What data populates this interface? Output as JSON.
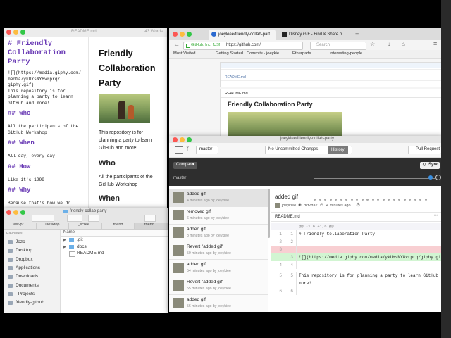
{
  "colors": {
    "accent": "#2d7bd4",
    "md_heading": "#6a3bb5",
    "deletion": "#f8cfd2",
    "addition": "#d2f5d2"
  },
  "editor": {
    "file": "README.md",
    "words": "43 Words",
    "md_lines": [
      {
        "kind": "h",
        "text": "# Friendly"
      },
      {
        "kind": "h",
        "text": "Collaboration"
      },
      {
        "kind": "h",
        "text": "Party"
      },
      {
        "kind": "t",
        "text": "![](https://media.giphy.com/"
      },
      {
        "kind": "t",
        "text": "media/ykUYsNY8vrprq/"
      },
      {
        "kind": "t",
        "text": "giphy.gif)"
      },
      {
        "kind": "t",
        "text": "This repository is for"
      },
      {
        "kind": "t",
        "text": "planning a party to learn"
      },
      {
        "kind": "t",
        "text": "GitHub and more!"
      },
      {
        "kind": "h2",
        "text": "## Who"
      },
      {
        "kind": "t",
        "text": "All the participants of the"
      },
      {
        "kind": "t",
        "text": "GitHub Workshop"
      },
      {
        "kind": "h2",
        "text": "## When"
      },
      {
        "kind": "t",
        "text": "All day, every day"
      },
      {
        "kind": "h2",
        "text": "## How"
      },
      {
        "kind": "t",
        "text": "Like it's 1999"
      },
      {
        "kind": "h2",
        "text": "## Why"
      },
      {
        "kind": "t",
        "text": "Because that's how we do"
      }
    ],
    "preview": {
      "title": "Friendly Collaboration Party",
      "para": "This repository is for planning a party to learn GitHub and more!",
      "who": "Who",
      "who_text": "All the participants of the GitHub Workshop",
      "when": "When"
    }
  },
  "browser": {
    "tabs": [
      {
        "label": "joeykiee/friendly-collab-part",
        "active": true
      },
      {
        "label": "Disney GIF - Find & Share o",
        "active": false
      }
    ],
    "secure_label": "GitHub, Inc. [US]",
    "url": "https://github.com/",
    "search_placeholder": "Search",
    "bookmarks": [
      "Most Visited",
      "Getting Started",
      "Commits · joeykie...",
      "Etherpads",
      "interesting-people"
    ],
    "page_rows": [
      "README.md",
      "README.md"
    ],
    "readme_title": "Friendly Collaboration Party"
  },
  "desktop": {
    "repo_title": "joeykiee/friendly-collab-party",
    "branch": "master",
    "tab_changes": "No Uncommitted Changes",
    "tab_history": "History",
    "pull_request": "Pull Request",
    "compare": "Compare",
    "sync": "Sync",
    "timeline_label": "master",
    "history": [
      {
        "title": "added gif",
        "meta": "4 minutes ago by joeykiee"
      },
      {
        "title": "removed gif",
        "meta": "6 minutes ago by joeykiee"
      },
      {
        "title": "added gif",
        "meta": "8 minutes ago by joeykiee"
      },
      {
        "title": "Revert \"added gif\"",
        "meta": "50 minutes ago by joeykiee"
      },
      {
        "title": "added gif",
        "meta": "54 minutes ago by joeykiee"
      },
      {
        "title": "Revert \"added gif\"",
        "meta": "55 minutes ago by joeykiee"
      },
      {
        "title": "added gif",
        "meta": "56 minutes ago by joeykiee"
      }
    ],
    "commit": {
      "title": "added gif",
      "author": "joeykiee",
      "sha": "dcf2da2",
      "time": "4 minutes ago",
      "file": "README.md",
      "hunk": "@@ -1,6 +1,6 @@",
      "lines": [
        {
          "old": "1",
          "new": "1",
          "type": "ctx",
          "text": "# Friendly Collaboration Party"
        },
        {
          "old": "2",
          "new": "2",
          "type": "ctx",
          "text": ""
        },
        {
          "old": "3",
          "new": "",
          "type": "del",
          "text": ""
        },
        {
          "old": "",
          "new": "3",
          "type": "add",
          "text": "![](https://media.giphy.com/media/ykUYsNY8vrprq/giphy.gif)"
        },
        {
          "old": "4",
          "new": "4",
          "type": "ctx",
          "text": ""
        },
        {
          "old": "5",
          "new": "5",
          "type": "ctx",
          "text": "This repository is for planning a party to learn GitHub and"
        },
        {
          "old": "",
          "new": "",
          "type": "ctx",
          "text": "more!"
        },
        {
          "old": "6",
          "new": "6",
          "type": "ctx",
          "text": ""
        }
      ]
    }
  },
  "finder": {
    "title": "friendly-collab-party",
    "tabs": [
      "test-pr...",
      "Desktop",
      "_scree...",
      "friend",
      "friend..."
    ],
    "sidebar_header": "Favorites",
    "sidebar": [
      "Jozo",
      "Desktop",
      "Dropbox",
      "Applications",
      "Downloads",
      "Documents",
      "_Projects",
      "friendly-github..."
    ],
    "column": "Name",
    "files": [
      {
        "name": ".git",
        "type": "folder"
      },
      {
        "name": "docs",
        "type": "folder"
      },
      {
        "name": "README.md",
        "type": "file"
      }
    ]
  }
}
